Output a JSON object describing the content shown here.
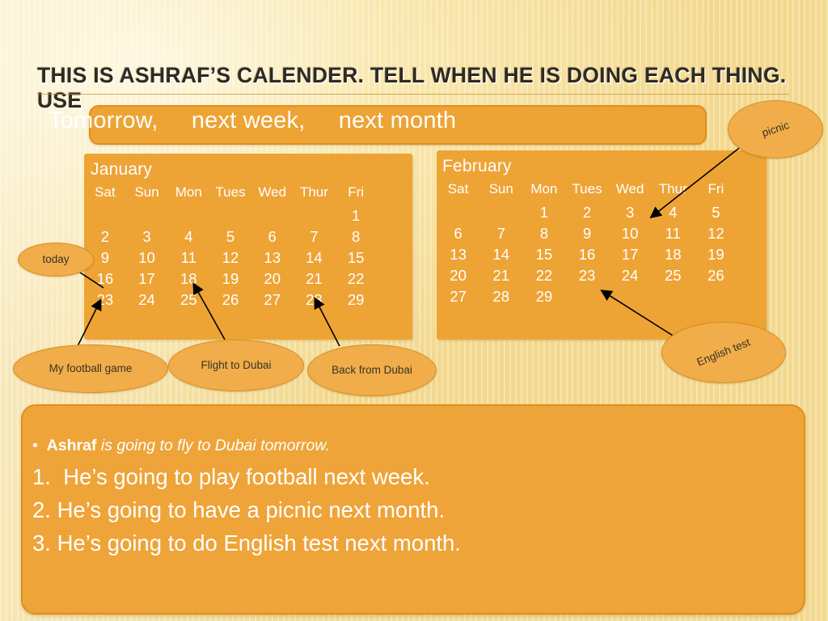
{
  "slide": {
    "title": "THIS IS ASHRAF’S CALENDER. TELL WHEN HE IS DOING EACH THING. USE",
    "prompt": "Tomorrow,     next week,     next month"
  },
  "calendars": [
    {
      "name": "January",
      "dow": [
        "Sat",
        "Sun",
        "Mon",
        "Tues",
        "Wed",
        "Thur",
        "Fri"
      ],
      "cells": [
        "",
        "",
        "",
        "",
        "",
        "",
        "1",
        "2",
        "3",
        "4",
        "5",
        "6",
        "7",
        "8",
        "9",
        "10",
        "11",
        "12",
        "13",
        "14",
        "15",
        "16",
        "17",
        "18",
        "19",
        "20",
        "21",
        "22",
        "23",
        "24",
        "25",
        "26",
        "27",
        "28",
        "29"
      ]
    },
    {
      "name": "February",
      "dow": [
        "Sat",
        "Sun",
        "Mon",
        "Tues",
        "Wed",
        "Thur",
        "Fri"
      ],
      "cells": [
        "",
        "",
        "1",
        "2",
        "3",
        "4",
        "5",
        "6",
        "7",
        "8",
        "9",
        "10",
        "11",
        "12",
        "13",
        "14",
        "15",
        "16",
        "17",
        "18",
        "19",
        "20",
        "21",
        "22",
        "23",
        "24",
        "25",
        "26",
        "27",
        "28",
        "29",
        "",
        "",
        "",
        ""
      ]
    }
  ],
  "bubbles": {
    "today": "today",
    "picnic": "picnic",
    "english_test": "English test",
    "football": "My football game",
    "flight": "Flight to Dubai",
    "back": "Back from Dubai"
  },
  "answers": {
    "example_prefix": "•  ",
    "example_bold": "Ashraf",
    "example_rest": " is going to fly to Dubai tomorrow.",
    "items": [
      "1.  He’s going to play football next week.",
      "2. He’s going to have a picnic next month.",
      "3. He’s going to do English test next month."
    ]
  },
  "colors": {
    "panel": "#eea335",
    "panel_border": "#df8f1d",
    "bubble": "#f0ad4a",
    "bubble_border": "#d98c22",
    "text_light": "#ffffff",
    "title_text": "#2f2a21",
    "background": "#f6e4a8"
  }
}
